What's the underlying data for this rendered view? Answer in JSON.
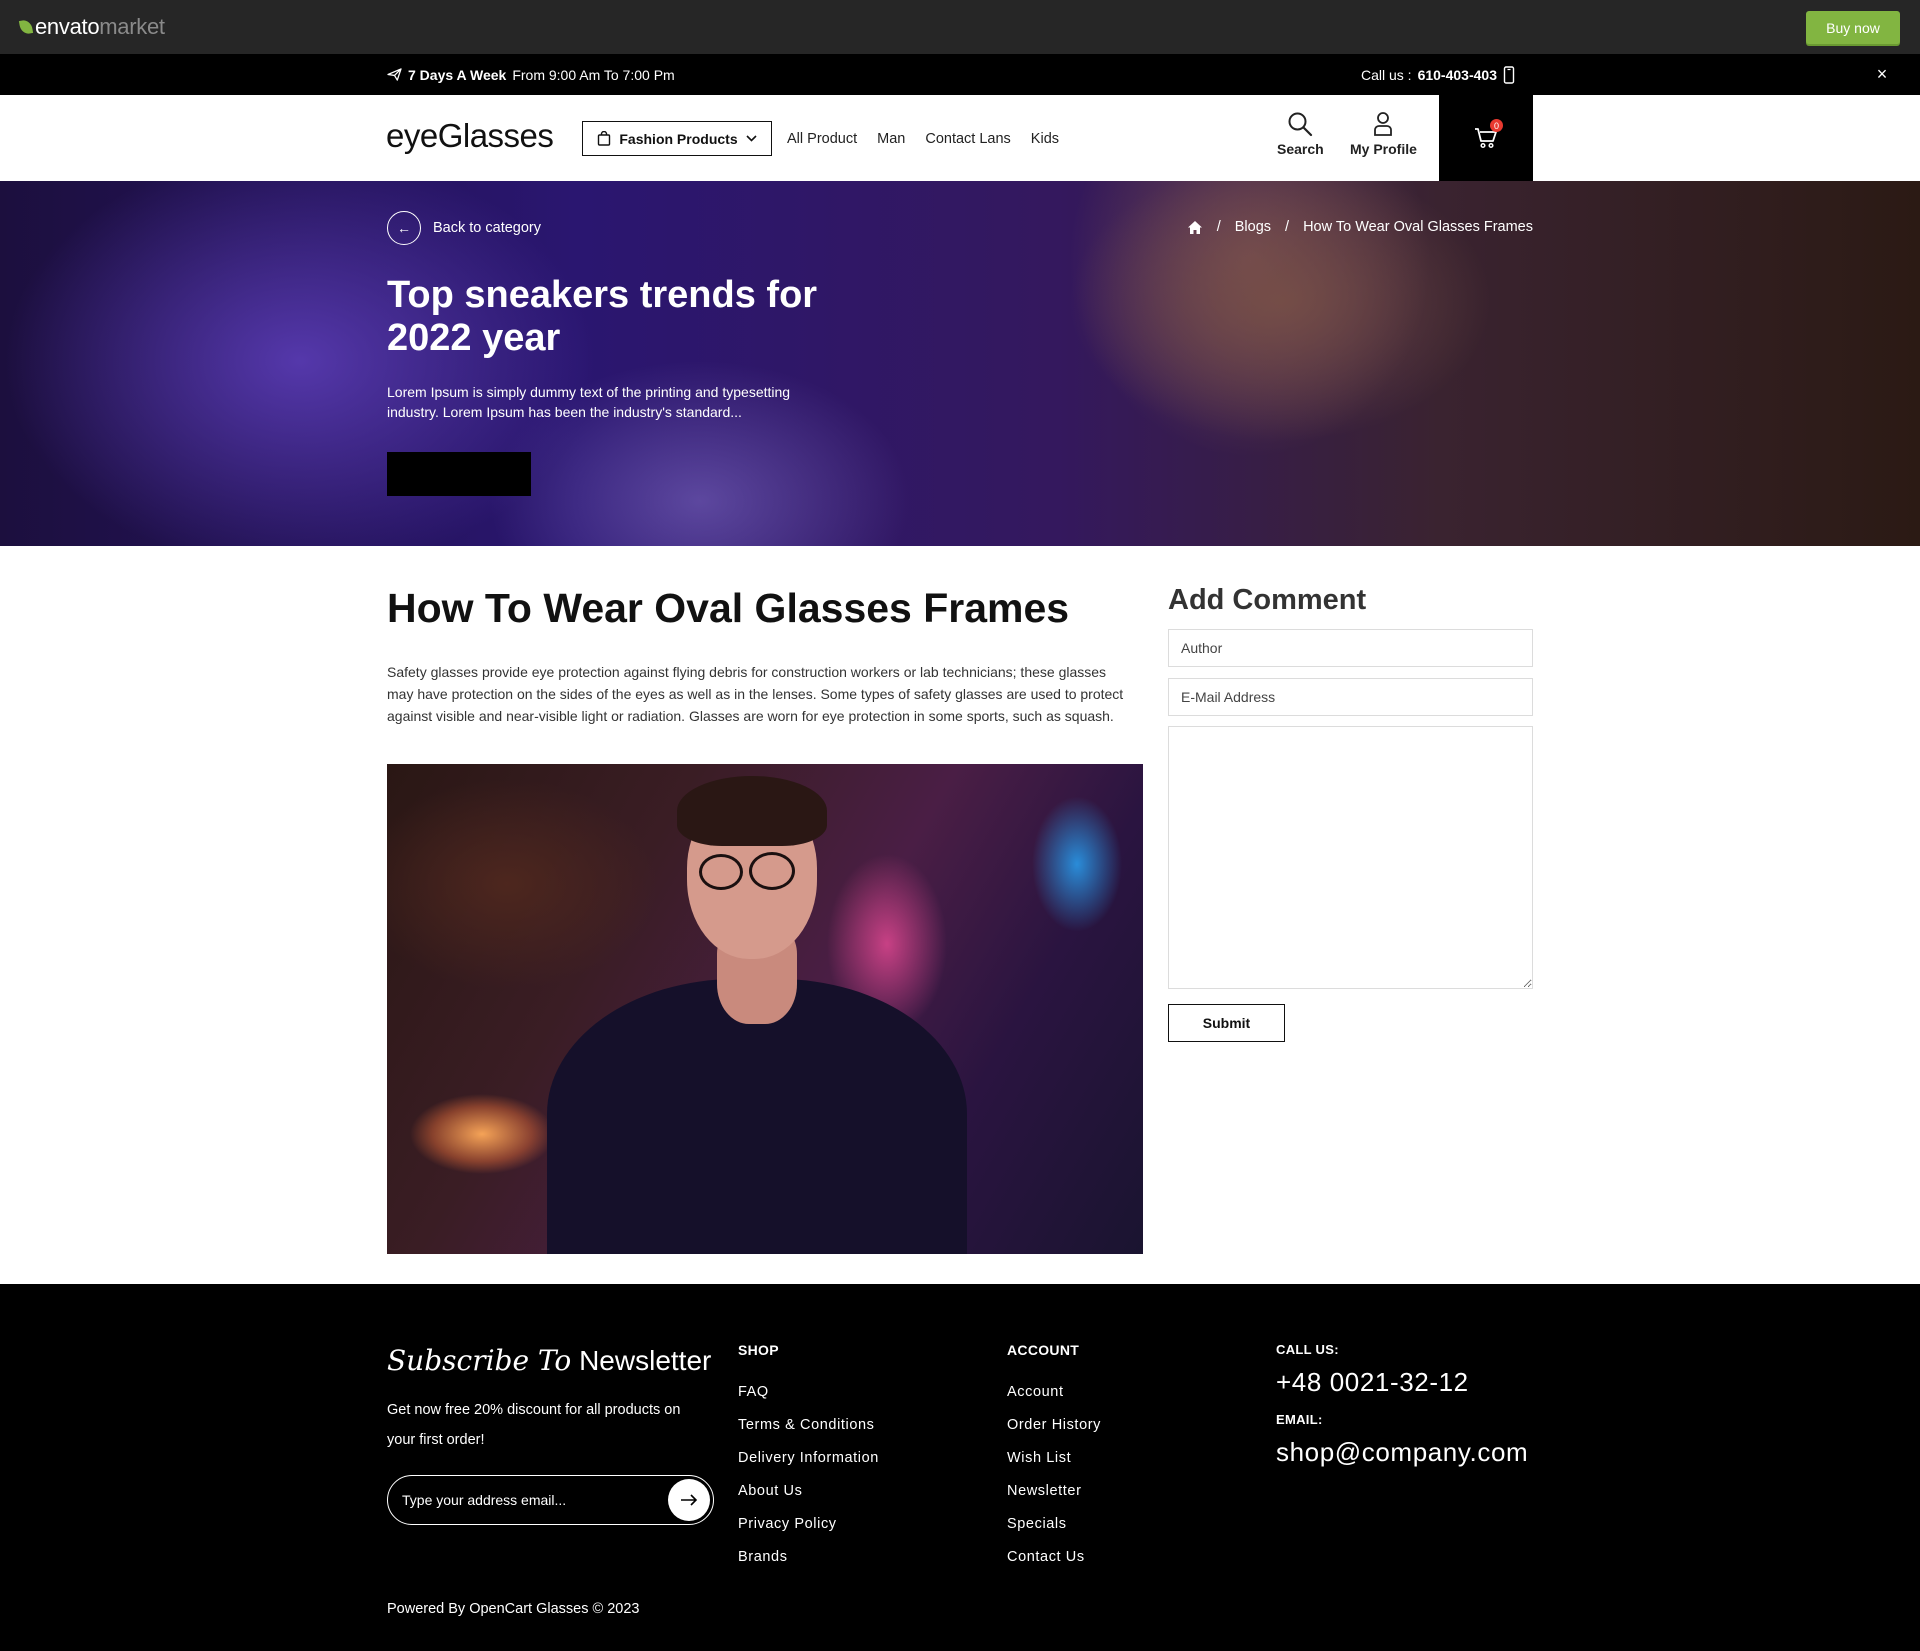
{
  "envato": {
    "logo_word1": "envato",
    "logo_word2": "market",
    "buy_now": "Buy now",
    "accent": "#82b541"
  },
  "topbar": {
    "hours_bold": "7 Days A Week",
    "hours_rest": "From 9:00 Am To 7:00 Pm",
    "call_label": "Call us :",
    "phone": "610-403-403",
    "close_glyph": "×"
  },
  "header": {
    "brand": "eyeGlasses",
    "category_button": "Fashion Products",
    "nav": [
      "All Product",
      "Man",
      "Contact Lans",
      "Kids"
    ],
    "search_label": "Search",
    "profile_label": "My Profile",
    "cart_count": "0"
  },
  "hero": {
    "back_label": "Back to category",
    "breadcrumb": [
      "Blogs",
      "How To Wear Oval Glasses Frames"
    ],
    "breadcrumb_sep": "/",
    "title": "Top sneakers trends for 2022 year",
    "description": "Lorem Ipsum is simply dummy text of the printing and typesetting industry. Lorem Ipsum has been the industry's standard..."
  },
  "article": {
    "title": "How To Wear Oval Glasses Frames",
    "body": "Safety glasses provide eye protection against flying debris for construction workers or lab technicians; these glasses may have protection on the sides of the eyes as well as in the lenses. Some types of safety glasses are used to protect against visible and near-visible light or radiation. Glasses are worn for eye protection in some sports, such as squash."
  },
  "comment": {
    "title": "Add Comment",
    "author_placeholder": "Author",
    "email_placeholder": "E-Mail Address",
    "submit": "Submit"
  },
  "footer": {
    "newsletter_italic": "Subscribe To",
    "newsletter_plain": "Newsletter",
    "newsletter_desc": "Get now free 20% discount for all products on your first order!",
    "email_placeholder": "Type your address email...",
    "shop_title": "SHOP",
    "shop_links": [
      "FAQ",
      "Terms & Conditions",
      "Delivery Information",
      "About Us",
      "Privacy Policy",
      "Brands"
    ],
    "account_title": "ACCOUNT",
    "account_links": [
      "Account",
      "Order History",
      "Wish List",
      "Newsletter",
      "Specials",
      "Contact Us"
    ],
    "call_label": "CALL US:",
    "phone": "+48 0021-32-12",
    "email_label": "EMAIL:",
    "email": "shop@company.com",
    "copyright": "Powered By OpenCart Glasses © 2023"
  }
}
